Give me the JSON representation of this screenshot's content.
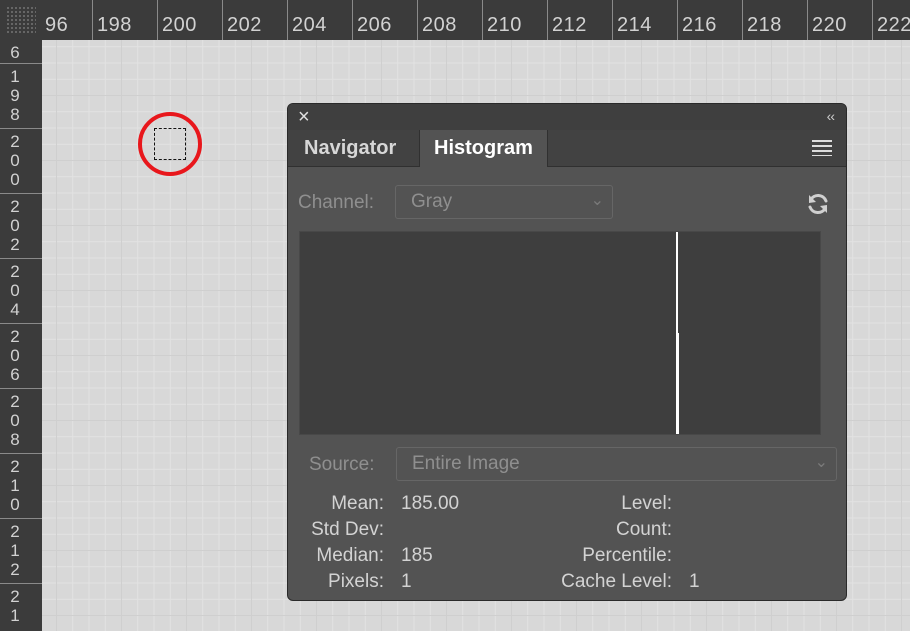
{
  "ruler": {
    "top_labels": [
      "96",
      "198",
      "200",
      "202",
      "204",
      "206",
      "208",
      "210",
      "212",
      "214",
      "216",
      "218",
      "220",
      "222"
    ],
    "left_labels": [
      "6",
      "198",
      "200",
      "202",
      "204",
      "206",
      "208",
      "210",
      "212",
      "21"
    ]
  },
  "panel": {
    "tabs": [
      {
        "label": "Navigator",
        "active": false
      },
      {
        "label": "Histogram",
        "active": true
      }
    ],
    "close_icon": "×",
    "collapse_icon": "‹‹",
    "channel": {
      "label": "Channel:",
      "value": "Gray"
    },
    "source": {
      "label": "Source:",
      "value": "Entire Image"
    },
    "histogram": {
      "level_value": 185,
      "scale_max": 255,
      "bar_color": "#ffffff"
    },
    "stats_left": [
      {
        "label": "Mean:",
        "value": "185.00"
      },
      {
        "label": "Std Dev:",
        "value": ""
      },
      {
        "label": "Median:",
        "value": "185"
      },
      {
        "label": "Pixels:",
        "value": "1"
      }
    ],
    "stats_right": [
      {
        "label": "Level:",
        "value": ""
      },
      {
        "label": "Count:",
        "value": ""
      },
      {
        "label": "Percentile:",
        "value": ""
      },
      {
        "label": "Cache Level:",
        "value": "1"
      }
    ]
  },
  "colors": {
    "panel_bg": "#535353",
    "highlight_circle": "#e8171c",
    "ruler_bg": "#3b3b3b"
  },
  "icons": [
    "close-icon",
    "collapse-icon",
    "panel-menu-icon",
    "chevron-down-icon",
    "refresh-icon"
  ]
}
